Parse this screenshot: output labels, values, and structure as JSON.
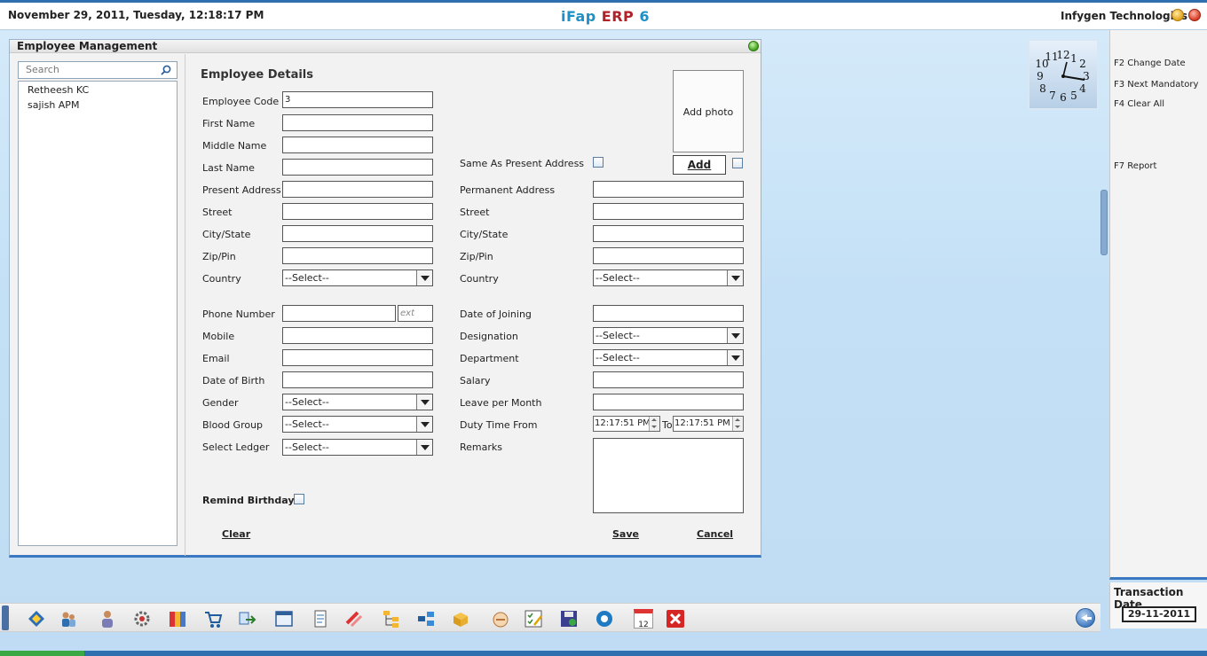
{
  "header": {
    "datetime": "November  29, 2011, Tuesday, 12:18:17 PM",
    "brand_part1": "iFap ",
    "brand_part2": "ERP",
    "brand_part3": " 6",
    "company": "Infygen Technologies"
  },
  "window": {
    "title": "Employee Management",
    "search_placeholder": "Search",
    "employees": [
      "Retheesh KC",
      "sajish APM"
    ]
  },
  "form": {
    "title": "Employee Details",
    "labels": {
      "employee_code": "Employee Code",
      "first_name": "First Name",
      "middle_name": "Middle Name",
      "last_name": "Last Name",
      "present_address": "Present Address",
      "street": "Street",
      "city_state": "City/State",
      "zip": "Zip/Pin",
      "country": "Country",
      "phone": "Phone Number",
      "mobile": "Mobile",
      "email": "Email",
      "dob": "Date of Birth",
      "gender": "Gender",
      "blood_group": "Blood Group",
      "select_ledger": "Select Ledger",
      "remind_birthday": "Remind Birthday",
      "same_as_present": "Same As Present  Address",
      "permanent_address": "Permanent Address",
      "date_of_joining": "Date of Joining",
      "designation": "Designation",
      "department": "Department",
      "salary": "Salary",
      "leave_per_month": "Leave per Month",
      "duty_time_from": "Duty Time From",
      "to": "To",
      "remarks": "Remarks"
    },
    "values": {
      "employee_code": "3",
      "ext_placeholder": "ext",
      "select_placeholder": "--Select--",
      "duty_from": "12:17:51 PM",
      "duty_to": "12:17:51 PM"
    },
    "photo_label": "Add photo",
    "add_button": "Add",
    "clear_button": "Clear",
    "save_button": "Save",
    "cancel_button": "Cancel"
  },
  "right_panel": {
    "f2": "F2 Change Date",
    "f3": "F3 Next Mandatory",
    "f4": "F4 Clear All",
    "f7": "F7 Report",
    "transaction_label": "Transaction Date",
    "transaction_date": "29-11-2011"
  },
  "clock": {
    "numerals": [
      "12",
      "1",
      "2",
      "3",
      "4",
      "5",
      "6",
      "7",
      "8",
      "9",
      "10",
      "11"
    ]
  },
  "toolbar": {
    "icons": [
      "dashboard-icon",
      "users-icon",
      "employee-icon",
      "settings-icon",
      "books-icon",
      "cart-icon",
      "transfer-icon",
      "window-icon",
      "document-icon",
      "tools-icon",
      "hierarchy-icon",
      "network-icon",
      "box-icon",
      "hand-icon",
      "checklist-icon",
      "save-icon",
      "gear-icon",
      "calendar-icon",
      "close-icon"
    ],
    "calendar_day": "12",
    "accent": "#2f6fb0"
  }
}
